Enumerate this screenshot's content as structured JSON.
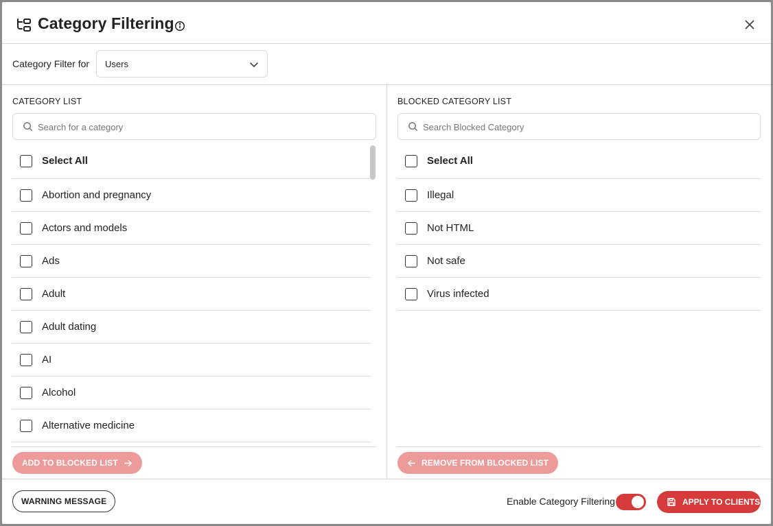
{
  "header": {
    "title": "Category Filtering",
    "icons": {
      "title": "category-tree-icon",
      "info": "info-icon",
      "close": "close-icon"
    }
  },
  "filter": {
    "label": "Category Filter for",
    "selected": "Users"
  },
  "category_list": {
    "heading": "CATEGORY LIST",
    "search_placeholder": "Search for a category",
    "select_all": "Select All",
    "items": [
      "Abortion and pregnancy",
      "Actors and models",
      "Ads",
      "Adult",
      "Adult dating",
      "AI",
      "Alcohol",
      "Alternative medicine"
    ],
    "button": "ADD TO BLOCKED LIST"
  },
  "blocked_list": {
    "heading": "BLOCKED CATEGORY LIST",
    "search_placeholder": "Search Blocked Category",
    "select_all": "Select All",
    "items": [
      "Illegal",
      "Not HTML",
      "Not safe",
      "Virus infected"
    ],
    "button": "REMOVE FROM BLOCKED LIST"
  },
  "footer": {
    "warning_button": "WARNING MESSAGE",
    "enable_label": "Enable Category Filtering",
    "enable_on": true,
    "apply_button": "APPLY TO CLIENTS"
  },
  "colors": {
    "accent": "#d53b3b",
    "accent_disabled": "#ec9a9a",
    "border": "#d6d6d6"
  }
}
